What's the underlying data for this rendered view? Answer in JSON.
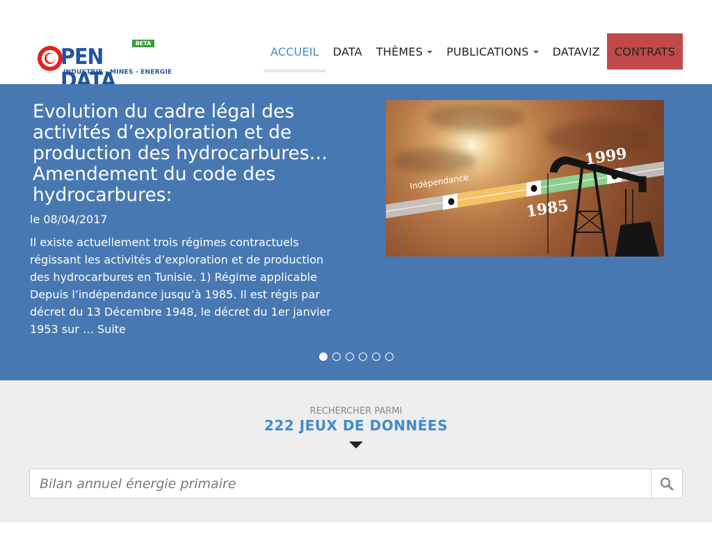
{
  "logo": {
    "title": "PEN DATA",
    "badge": "BETA",
    "subtitle": "INDUSTRIE - MINES - ENERGIE"
  },
  "nav": {
    "items": [
      {
        "label": "ACCUEIL",
        "active": true
      },
      {
        "label": "DATA"
      },
      {
        "label": "THÈMES",
        "dropdown": true
      },
      {
        "label": "PUBLICATIONS",
        "dropdown": true
      },
      {
        "label": "DATAVIZ"
      },
      {
        "label": "CONTRATS",
        "highlight": "#c0494a"
      }
    ]
  },
  "slide": {
    "title": "Evolution du cadre légal des activités d’exploration et de production des hydrocarbures… Amendement du code des hydrocarbures:",
    "date": "le 08/04/2017",
    "text": "Il existe actuellement trois régimes contractuels régissant les activités d’exploration et de production des hydrocarbures en Tunisie. 1) Régime applicable Depuis l’indépendance jusqu’à 1985. Il est régis par décret du 13 Décembre 1948, le décret du 1er janvier 1953 sur … Suite",
    "image": {
      "labels": {
        "start": "Indépendance",
        "mid": "1985",
        "end": "1999"
      },
      "colors": {
        "segment1": "#f3c265",
        "segment2": "#8fcf8e"
      }
    },
    "dots": {
      "count": 6,
      "active": 0
    }
  },
  "search": {
    "kicker": "RECHERCHER PARMI",
    "count": "222 JEUX DE DONNÉES",
    "placeholder": "Bilan annuel énergie primaire",
    "icon": "search-icon"
  },
  "colors": {
    "accent": "#428bca",
    "hero": "#4778b2",
    "contract": "#c0494a",
    "search_bg": "#eeeeee"
  }
}
